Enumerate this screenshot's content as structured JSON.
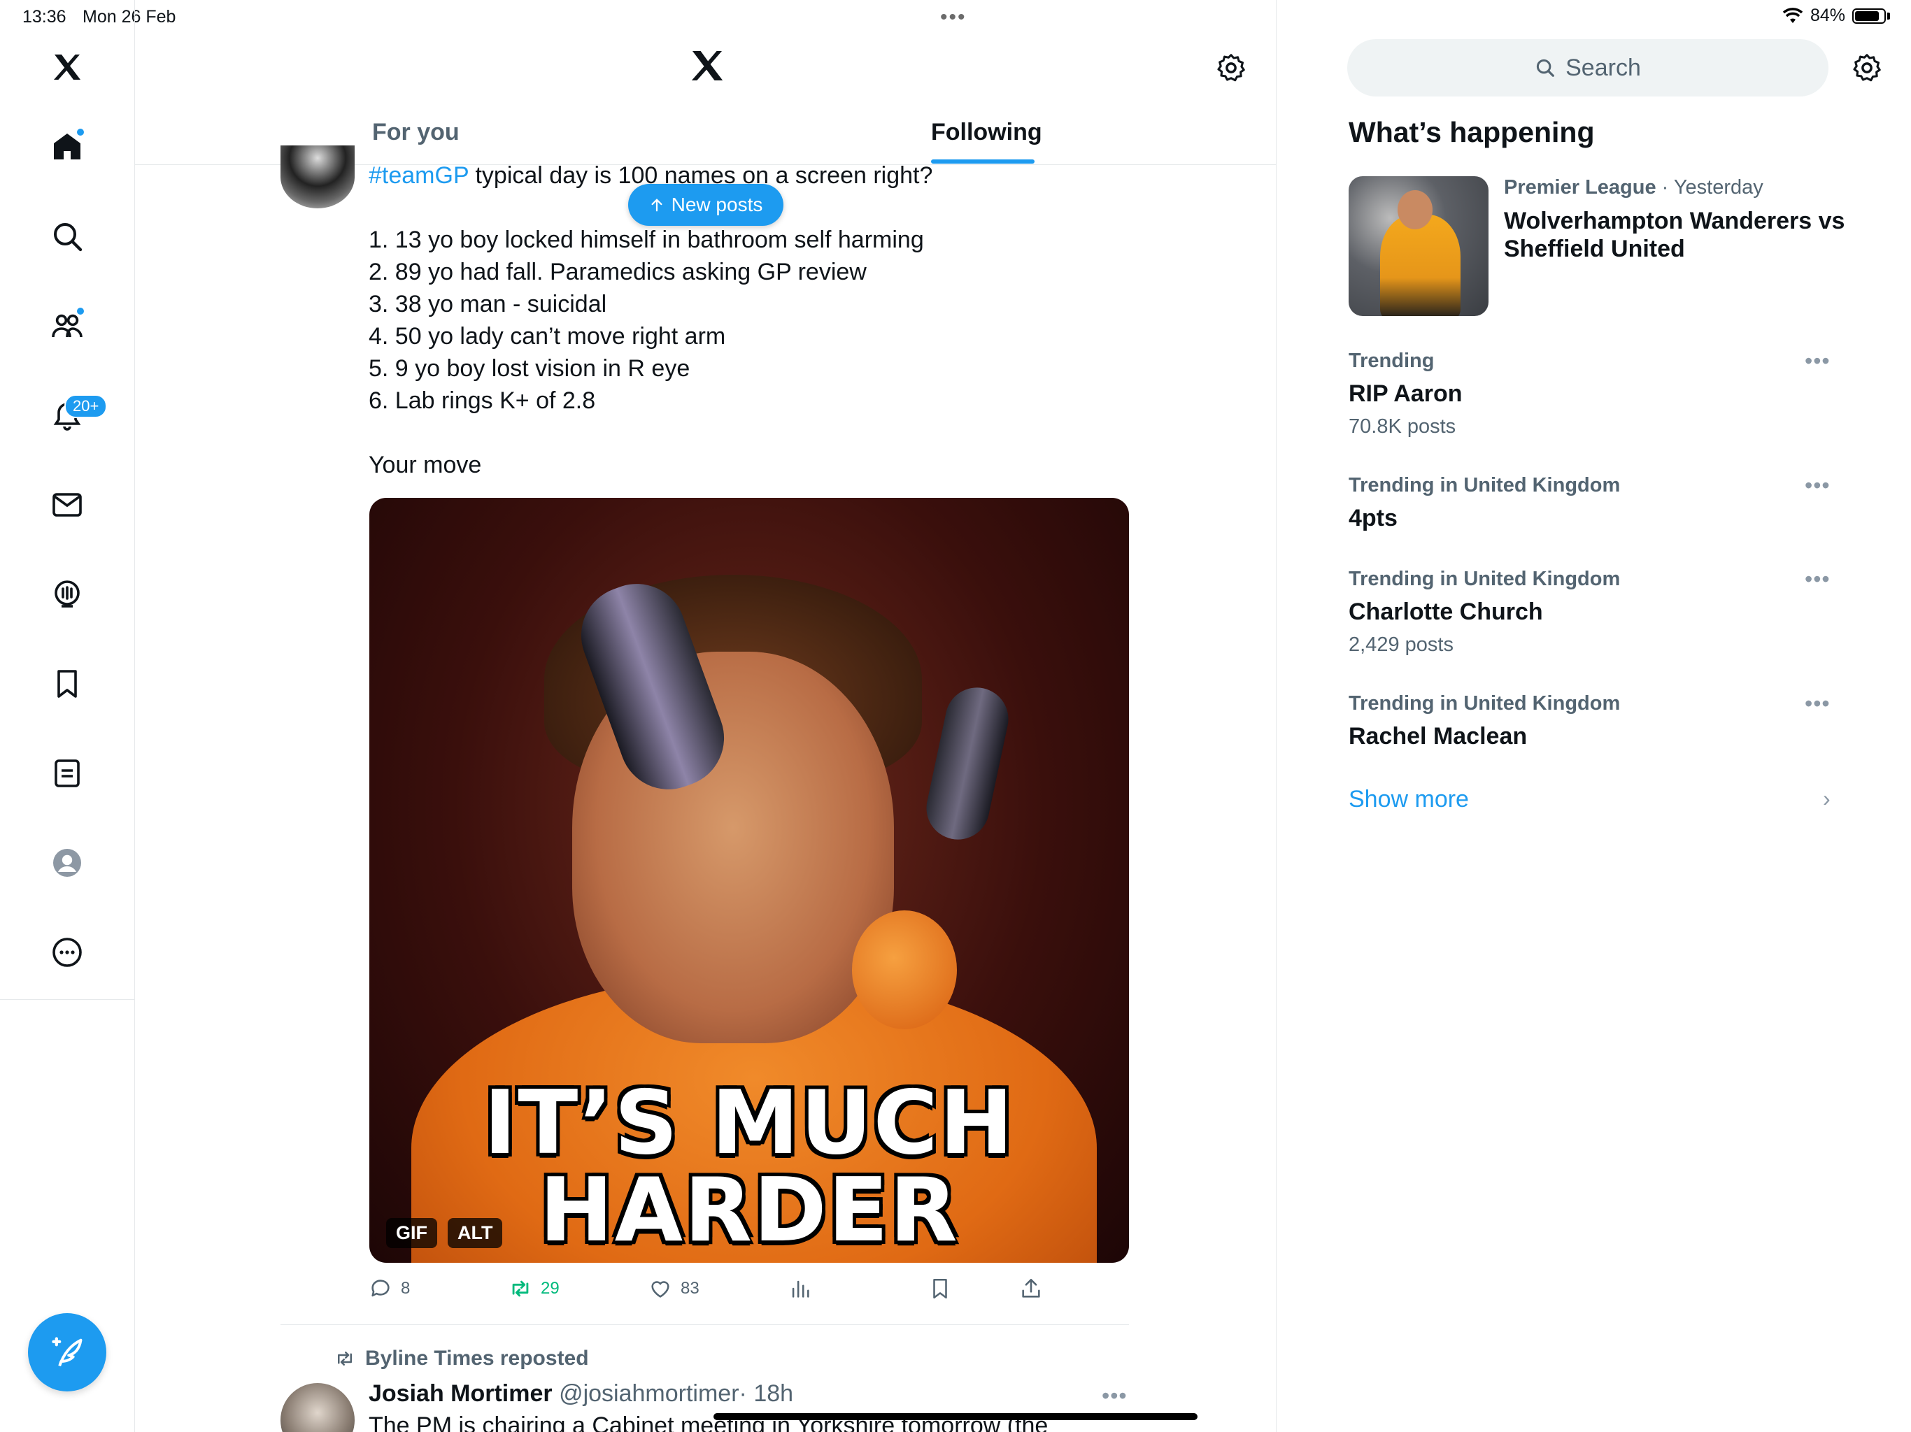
{
  "status_bar": {
    "time": "13:36",
    "date": "Mon 26 Feb",
    "battery": "84%",
    "battery_level": 0.84
  },
  "sidebar": {
    "items": [
      {
        "icon": "x-logo-icon"
      },
      {
        "icon": "home-icon"
      },
      {
        "icon": "search-icon"
      },
      {
        "icon": "communities-icon"
      },
      {
        "icon": "notifications-icon",
        "badge": "20+"
      },
      {
        "icon": "messages-icon"
      },
      {
        "icon": "spaces-icon"
      },
      {
        "icon": "bookmarks-icon"
      },
      {
        "icon": "lists-icon"
      },
      {
        "icon": "profile-icon"
      },
      {
        "icon": "more-icon"
      }
    ],
    "compose_icon": "compose-icon"
  },
  "header": {
    "tabs": [
      {
        "label": "For you",
        "active": false
      },
      {
        "label": "Following",
        "active": true
      }
    ]
  },
  "tweet": {
    "hashtag": "#teamGP",
    "text_line1": " typical day is 100 names on a screen right?",
    "lines": [
      "1. 13 yo boy locked himself in bathroom self harming",
      "2. 89 yo had fall. Paramedics asking GP review",
      "3. 38 yo man - suicidal",
      "4. 50 yo lady can’t move right arm",
      "5. 9 yo boy lost vision in R eye",
      "6. Lab rings K+ of 2.8"
    ],
    "closing": "Your move",
    "media": {
      "caption_line1": "IT’S MUCH",
      "caption_line2": "HARDER",
      "gif_label": "GIF",
      "alt_label": "ALT"
    },
    "actions": {
      "replies": "8",
      "reposts": "29",
      "likes": "83"
    }
  },
  "new_posts_label": "New posts",
  "next_tweet": {
    "repost_by": "Byline Times reposted",
    "author_name": "Josiah Mortimer",
    "author_handle": "@josiahmortimer",
    "time": "· 18h",
    "text": "The PM is chairing a Cabinet meeting in Yorkshire tomorrow (the"
  },
  "right": {
    "search_placeholder": "Search",
    "section_title": "What’s happening",
    "news": {
      "category": "Premier League",
      "time": " · Yesterday",
      "title": "Wolverhampton Wanderers vs Sheffield United"
    },
    "trends": [
      {
        "category": "Trending",
        "name": "RIP Aaron",
        "count": "70.8K posts"
      },
      {
        "category": "Trending in United Kingdom",
        "name": "4pts",
        "count": ""
      },
      {
        "category": "Trending in United Kingdom",
        "name": "Charlotte Church",
        "count": "2,429 posts"
      },
      {
        "category": "Trending in United Kingdom",
        "name": "Rachel Maclean",
        "count": ""
      }
    ],
    "show_more": "Show more"
  },
  "colors": {
    "accent": "#1d9bf0",
    "text_primary": "#0f1419",
    "text_secondary": "#536471",
    "repost_green": "#00ba7c"
  }
}
